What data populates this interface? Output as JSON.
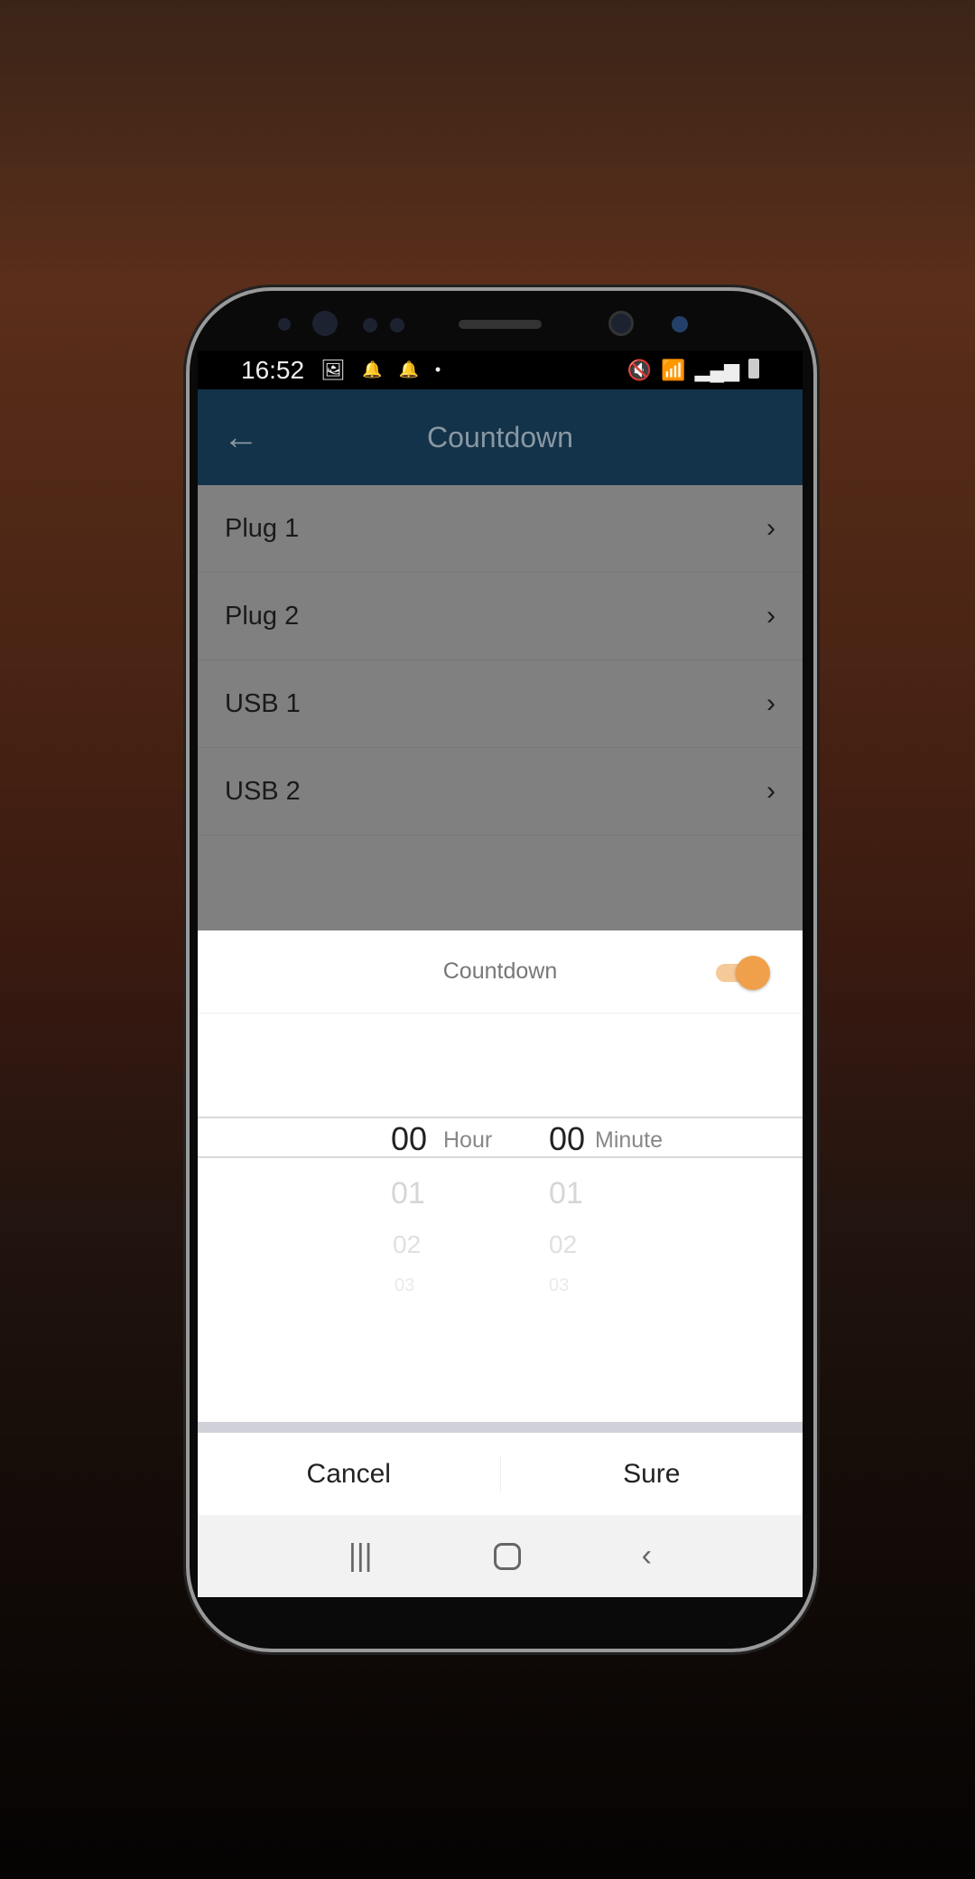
{
  "status_bar": {
    "time": "16:52",
    "left_icons": [
      "image-icon",
      "bell-icon",
      "bell-icon",
      "dot-icon"
    ],
    "right_icons": [
      "mute-icon",
      "wifi-icon",
      "signal-icon",
      "battery-icon"
    ]
  },
  "app_bar": {
    "title": "Countdown",
    "back_icon": "arrow-left-icon",
    "color": "#123349"
  },
  "list": [
    {
      "label": "Plug 1"
    },
    {
      "label": "Plug 2"
    },
    {
      "label": "USB 1"
    },
    {
      "label": "USB 2"
    }
  ],
  "sheet": {
    "title": "Countdown",
    "toggle_on": true,
    "accent": "#f0a04a",
    "picker": {
      "hour": {
        "selected": "00",
        "unit": "Hour",
        "below": [
          "01",
          "02",
          "03"
        ]
      },
      "minute": {
        "selected": "00",
        "unit": "Minute",
        "below": [
          "01",
          "02",
          "03"
        ]
      }
    },
    "cancel": "Cancel",
    "confirm": "Sure"
  },
  "nav_bar": {
    "icons": [
      "recent-apps-icon",
      "home-icon",
      "back-icon"
    ]
  }
}
